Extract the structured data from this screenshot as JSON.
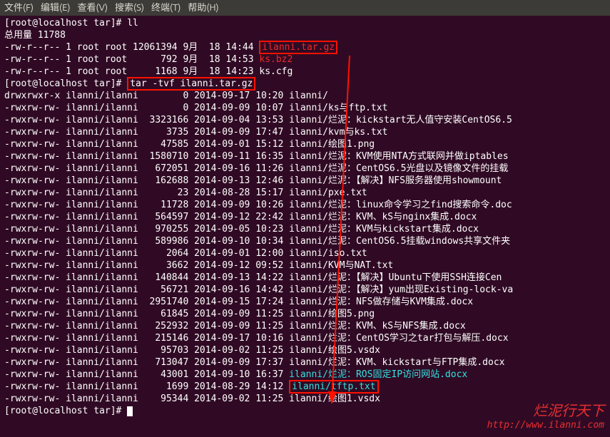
{
  "menubar": {
    "file": "文件(F)",
    "edit": "编辑(E)",
    "view": "查看(V)",
    "search": "搜索(S)",
    "terminal": "终端(T)",
    "help": "帮助(H)"
  },
  "prompt": {
    "p1": "[root@localhost tar]# ",
    "cmd_ll": "ll",
    "total": "总用量 11788",
    "cmd_tar": "tar -tvf ilanni.tar.gz"
  },
  "ls": [
    {
      "perm": "-rw-r--r--",
      "lnk": "1",
      "own": "root root",
      "size": "12061394",
      "date": "9月  18 14:44",
      "name": "ilanni.tar.gz",
      "hl": "red"
    },
    {
      "perm": "-rw-r--r--",
      "lnk": "1",
      "own": "root root",
      "size": "     792",
      "date": "9月  18 14:53",
      "name": "ks.bz2",
      "hl": "redplain"
    },
    {
      "perm": "-rw-r--r--",
      "lnk": "1",
      "own": "root root",
      "size": "    1168",
      "date": "9月  18 14:23",
      "name": "ks.cfg",
      "hl": "none"
    }
  ],
  "tar": [
    {
      "perm": "drwxrwxr-x",
      "own": "ilanni/ilanni",
      "size": "       0",
      "date": "2014-09-17 10:20",
      "name": "ilanni/"
    },
    {
      "perm": "-rwxrw-rw-",
      "own": "ilanni/ilanni",
      "size": "       0",
      "date": "2014-09-09 10:07",
      "name": "ilanni/ks与ftp.txt"
    },
    {
      "perm": "-rwxrw-rw-",
      "own": "ilanni/ilanni",
      "size": " 3323166",
      "date": "2014-09-04 13:53",
      "name": "ilanni/烂泥：kickstart无人值守安装CentOS6.5"
    },
    {
      "perm": "-rwxrw-rw-",
      "own": "ilanni/ilanni",
      "size": "    3735",
      "date": "2014-09-09 17:47",
      "name": "ilanni/kvm与ks.txt"
    },
    {
      "perm": "-rwxrw-rw-",
      "own": "ilanni/ilanni",
      "size": "   47585",
      "date": "2014-09-01 15:12",
      "name": "ilanni/绘图1.png"
    },
    {
      "perm": "-rwxrw-rw-",
      "own": "ilanni/ilanni",
      "size": " 1580710",
      "date": "2014-09-11 16:35",
      "name": "ilanni/烂泥：KVM使用NTA方式联网并做iptables"
    },
    {
      "perm": "-rwxrw-rw-",
      "own": "ilanni/ilanni",
      "size": "  672051",
      "date": "2014-09-16 11:26",
      "name": "ilanni/烂泥：CentOS6.5光盘以及镜像文件的挂载"
    },
    {
      "perm": "-rwxrw-rw-",
      "own": "ilanni/ilanni",
      "size": "  162688",
      "date": "2014-09-13 12:46",
      "name": "ilanni/烂泥：【解决】NFS服务器使用showmount"
    },
    {
      "perm": "-rwxrw-rw-",
      "own": "ilanni/ilanni",
      "size": "      23",
      "date": "2014-08-28 15:17",
      "name": "ilanni/pxe.txt"
    },
    {
      "perm": "-rwxrw-rw-",
      "own": "ilanni/ilanni",
      "size": "   11728",
      "date": "2014-09-09 10:26",
      "name": "ilanni/烂泥：linux命令学习之find搜索命令.doc"
    },
    {
      "perm": "-rwxrw-rw-",
      "own": "ilanni/ilanni",
      "size": "  564597",
      "date": "2014-09-12 22:42",
      "name": "ilanni/烂泥：KVM、kS与nginx集成.docx"
    },
    {
      "perm": "-rwxrw-rw-",
      "own": "ilanni/ilanni",
      "size": "  970255",
      "date": "2014-09-05 10:23",
      "name": "ilanni/烂泥：KVM与kickstart集成.docx"
    },
    {
      "perm": "-rwxrw-rw-",
      "own": "ilanni/ilanni",
      "size": "  589986",
      "date": "2014-09-10 10:34",
      "name": "ilanni/烂泥：CentOS6.5挂载windows共享文件夹"
    },
    {
      "perm": "-rwxrw-rw-",
      "own": "ilanni/ilanni",
      "size": "    2064",
      "date": "2014-09-01 12:00",
      "name": "ilanni/iso.txt"
    },
    {
      "perm": "-rwxrw-rw-",
      "own": "ilanni/ilanni",
      "size": "    3662",
      "date": "2014-09-12 09:52",
      "name": "ilanni/KVM与NAT.txt"
    },
    {
      "perm": "-rwxrw-rw-",
      "own": "ilanni/ilanni",
      "size": "  140844",
      "date": "2014-09-13 14:22",
      "name": "ilanni/烂泥：【解决】Ubuntu下使用SSH连接Cen"
    },
    {
      "perm": "-rwxrw-rw-",
      "own": "ilanni/ilanni",
      "size": "   56721",
      "date": "2014-09-16 14:42",
      "name": "ilanni/烂泥：【解决】yum出现Existing-lock-va"
    },
    {
      "perm": "-rwxrw-rw-",
      "own": "ilanni/ilanni",
      "size": " 2951740",
      "date": "2014-09-15 17:24",
      "name": "ilanni/烂泥：NFS做存储与KVM集成.docx"
    },
    {
      "perm": "-rwxrw-rw-",
      "own": "ilanni/ilanni",
      "size": "   61845",
      "date": "2014-09-09 11:25",
      "name": "ilanni/绘图5.png"
    },
    {
      "perm": "-rwxrw-rw-",
      "own": "ilanni/ilanni",
      "size": "  252932",
      "date": "2014-09-09 11:25",
      "name": "ilanni/烂泥：KVM、kS与NFS集成.docx"
    },
    {
      "perm": "-rwxrw-rw-",
      "own": "ilanni/ilanni",
      "size": "  215146",
      "date": "2014-09-17 10:16",
      "name": "ilanni/烂泥：CentOS学习之tar打包与解压.docx"
    },
    {
      "perm": "-rwxrw-rw-",
      "own": "ilanni/ilanni",
      "size": "   95703",
      "date": "2014-09-02 11:25",
      "name": "ilanni/绘图5.vsdx"
    },
    {
      "perm": "-rwxrw-rw-",
      "own": "ilanni/ilanni",
      "size": "  713047",
      "date": "2014-09-09 17:37",
      "name": "ilanni/烂泥：KVM、kickstart与FTP集成.docx"
    },
    {
      "perm": "-rwxrw-rw-",
      "own": "ilanni/ilanni",
      "size": "   43001",
      "date": "2014-09-10 16:37",
      "name": "ilanni/烂泥：ROS固定IP访问网站.docx",
      "hlcyan": true
    },
    {
      "perm": "-rwxrw-rw-",
      "own": "ilanni/ilanni",
      "size": "    1699",
      "date": "2014-08-29 14:12",
      "name": "ilanni/tftp.txt",
      "hl": "box"
    },
    {
      "perm": "-rwxrw-rw-",
      "own": "ilanni/ilanni",
      "size": "   95344",
      "date": "2014-09-02 11:25",
      "name": "ilanni/绘图1.vsdx"
    }
  ],
  "watermark": {
    "title": "烂泥行天下",
    "url": "http://www.ilanni.com"
  }
}
